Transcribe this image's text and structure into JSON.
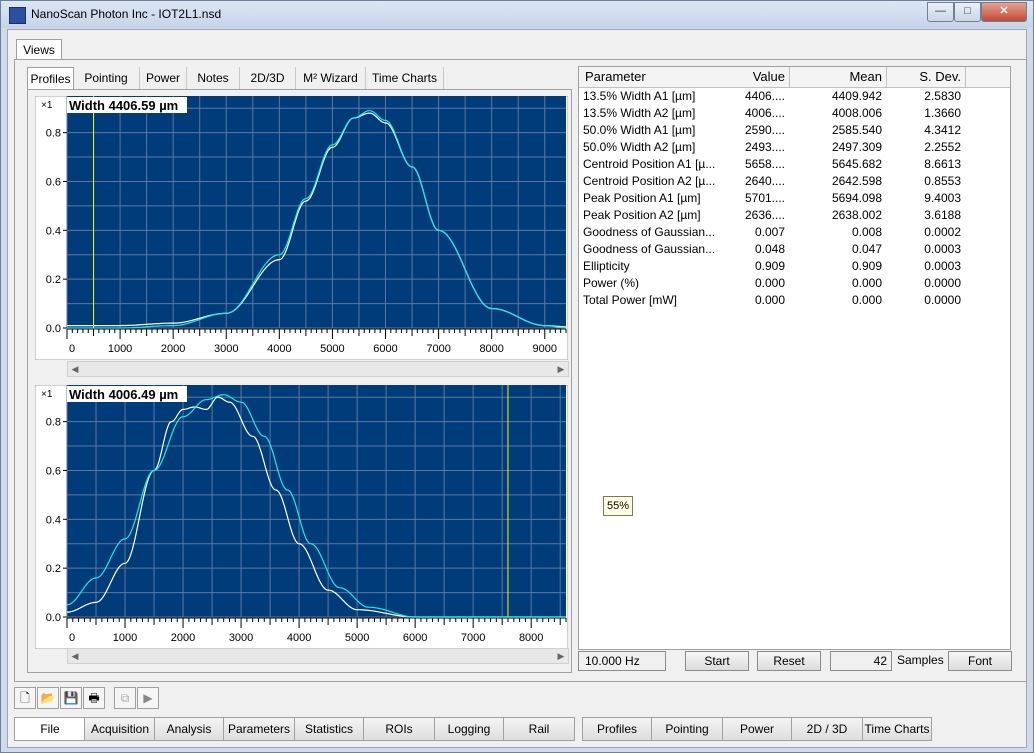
{
  "window": {
    "title": "NanoScan Photon Inc - IOT2L1.nsd",
    "controls": [
      "—",
      "□",
      "✕"
    ]
  },
  "views_tab": "Views",
  "subtabs": [
    "Profiles",
    "Pointing",
    "Power",
    "Notes",
    "2D/3D",
    "M² Wizard",
    "Time Charts"
  ],
  "plot1": {
    "width_label": "Width 4406.59 µm",
    "y_multiplier": "×1",
    "y_ticks": [
      "0.8",
      "0.6",
      "0.4",
      "0.2",
      "0.0"
    ],
    "x_ticks": [
      "0",
      "1000",
      "2000",
      "3000",
      "4000",
      "5000",
      "6000",
      "7000",
      "8000",
      "9000"
    ]
  },
  "plot2": {
    "width_label": "Width 4006.49 µm",
    "y_multiplier": "×1",
    "y_ticks": [
      "0.8",
      "0.6",
      "0.4",
      "0.2",
      "0.0"
    ],
    "x_ticks": [
      "0",
      "1000",
      "2000",
      "3000",
      "4000",
      "5000",
      "6000",
      "7000",
      "8000"
    ]
  },
  "chart_data": [
    {
      "type": "line",
      "title": "Width 4406.59 µm",
      "xlim": [
        0,
        9400
      ],
      "ylim": [
        0,
        0.95
      ],
      "grid": true,
      "series": [
        {
          "color": "#ffffff",
          "x": [
            0,
            1000,
            2000,
            3000,
            4000,
            4500,
            5000,
            5400,
            5700,
            6000,
            6500,
            7000,
            8000,
            9000,
            9400
          ],
          "y": [
            0.01,
            0.01,
            0.02,
            0.06,
            0.28,
            0.52,
            0.74,
            0.86,
            0.88,
            0.84,
            0.66,
            0.4,
            0.08,
            0.01,
            0.005
          ]
        },
        {
          "color": "#22e6e6",
          "x": [
            0,
            1000,
            2000,
            3000,
            4000,
            4500,
            5000,
            5400,
            5700,
            6000,
            6500,
            7000,
            8000,
            9000,
            9400
          ],
          "y": [
            0.0,
            0.0,
            0.01,
            0.06,
            0.3,
            0.53,
            0.75,
            0.86,
            0.89,
            0.85,
            0.66,
            0.4,
            0.08,
            0.01,
            0.0
          ]
        }
      ],
      "cursor_x": 500
    },
    {
      "type": "line",
      "title": "Width 4006.49 µm",
      "xlim": [
        0,
        8600
      ],
      "ylim": [
        0,
        0.95
      ],
      "grid": true,
      "series": [
        {
          "color": "#ffffff",
          "x": [
            0,
            500,
            1000,
            1500,
            1800,
            2000,
            2200,
            2400,
            2600,
            2800,
            3200,
            3600,
            4000,
            4500,
            5000,
            6000,
            7000,
            8600
          ],
          "y": [
            0.02,
            0.06,
            0.22,
            0.6,
            0.8,
            0.85,
            0.86,
            0.85,
            0.9,
            0.88,
            0.74,
            0.52,
            0.3,
            0.11,
            0.03,
            0.0,
            0.0,
            0.0
          ]
        },
        {
          "color": "#22e6e6",
          "x": [
            0,
            500,
            1000,
            1500,
            2000,
            2400,
            2700,
            3000,
            3400,
            3800,
            4200,
            4700,
            5200,
            6000,
            7000,
            8600
          ],
          "y": [
            0.05,
            0.16,
            0.32,
            0.6,
            0.82,
            0.89,
            0.91,
            0.88,
            0.74,
            0.52,
            0.3,
            0.12,
            0.04,
            0.0,
            0.0,
            0.0
          ]
        }
      ],
      "cursor_x": 7600
    }
  ],
  "grid": {
    "headers": [
      "Parameter",
      "Value",
      "Mean",
      "S. Dev."
    ],
    "rows": [
      [
        "13.5% Width A1 [µm]",
        "4406....",
        "4409.942",
        "2.5830"
      ],
      [
        "13.5% Width A2 [µm]",
        "4006....",
        "4008.006",
        "1.3660"
      ],
      [
        "50.0% Width A1 [µm]",
        "2590....",
        "2585.540",
        "4.3412"
      ],
      [
        "50.0% Width A2 [µm]",
        "2493....",
        "2497.309",
        "2.2552"
      ],
      [
        "Centroid Position A1 [µ...",
        "5658....",
        "5645.682",
        "8.6613"
      ],
      [
        "Centroid Position A2 [µ...",
        "2640....",
        "2642.598",
        "0.8553"
      ],
      [
        "Peak Position A1 [µm]",
        "5701....",
        "5694.098",
        "9.4003"
      ],
      [
        "Peak Position A2 [µm]",
        "2636....",
        "2638.002",
        "3.6188"
      ],
      [
        "Goodness of Gaussian...",
        "0.007",
        "0.008",
        "0.0002"
      ],
      [
        "Goodness of Gaussian...",
        "0.048",
        "0.047",
        "0.0003"
      ],
      [
        "Ellipticity",
        "0.909",
        "0.909",
        "0.0003"
      ],
      [
        "Power (%)",
        "0.000",
        "0.000",
        "0.0000"
      ],
      [
        "Total Power [mW]",
        "0.000",
        "0.000",
        "0.0000"
      ]
    ]
  },
  "tooltip": "55%",
  "bottom": {
    "rate": "10.000 Hz",
    "start": "Start",
    "reset": "Reset",
    "samples_value": "42",
    "samples_label": "Samples",
    "font": "Font"
  },
  "nav": [
    "File",
    "Acquisition",
    "Analysis",
    "Parameters",
    "Statistics",
    "ROIs",
    "Logging",
    "Rail",
    "Profiles",
    "Pointing",
    "Power",
    "2D / 3D",
    "Time Charts"
  ]
}
